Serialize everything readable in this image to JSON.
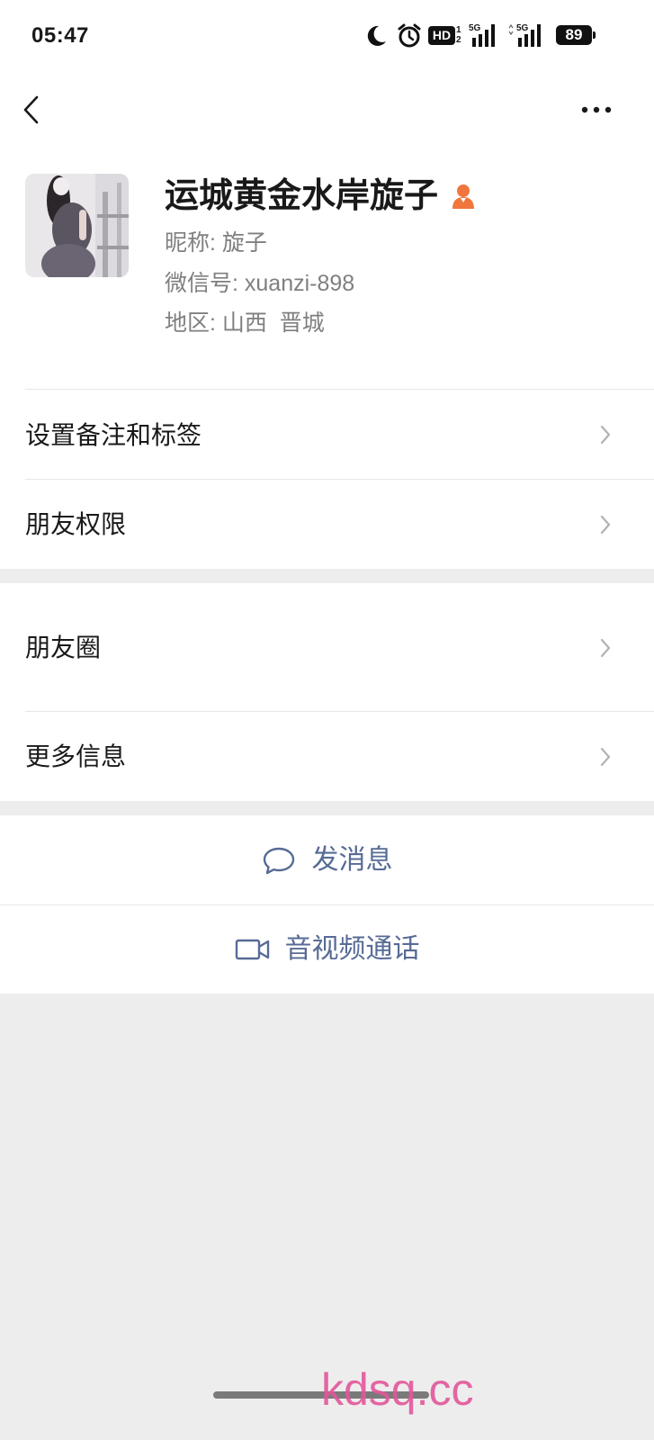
{
  "status_bar": {
    "time": "05:47",
    "moon_icon": "do-not-disturb-moon-icon",
    "alarm_icon": "alarm-clock-icon",
    "hd_label": "HD",
    "sim1": "1",
    "sim2": "2",
    "net1": "5G",
    "net2": "5G",
    "battery": "89"
  },
  "nav": {
    "back_icon": "chevron-left-icon",
    "more_icon": "more-dots-icon"
  },
  "profile": {
    "name": "运城黄金水岸旋子",
    "gender_icon": "female-icon",
    "nickname": "昵称: 旋子",
    "wechat_id": "微信号: xuanzi-898",
    "region": "地区: 山西  晋城"
  },
  "menu": {
    "group1": [
      {
        "label": "设置备注和标签"
      },
      {
        "label": "朋友权限"
      }
    ],
    "group2": [
      {
        "label": "朋友圈"
      },
      {
        "label": "更多信息"
      }
    ]
  },
  "actions": {
    "message": "发消息",
    "message_icon": "chat-bubble-icon",
    "call": "音视频通话",
    "call_icon": "video-camera-icon"
  },
  "colors": {
    "background": "#ededed",
    "text": "#191919",
    "secondary_text": "#7f7f7f",
    "action": "#576b95",
    "gender_accent": "#f0763d",
    "chevron": "#b2b2b2"
  },
  "watermark": "kdsq.cc"
}
